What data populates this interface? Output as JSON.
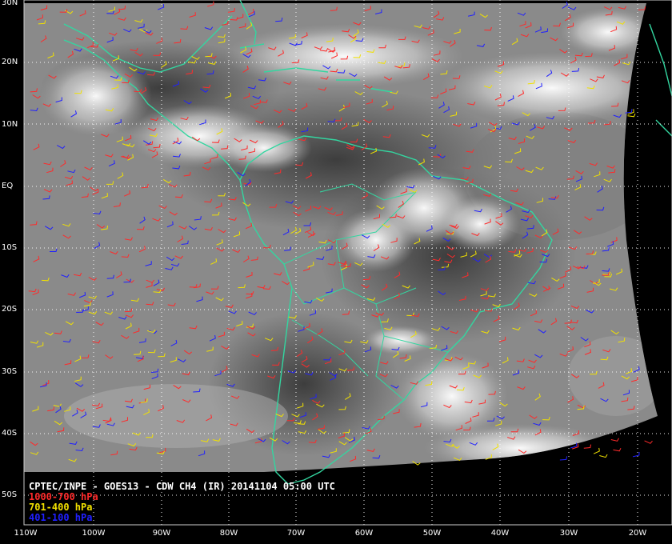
{
  "caption": {
    "title": "CPTEC/INPE - GOES13 - CDW CH4 (IR) 20141104 05:00 UTC",
    "legend": [
      {
        "label": "1000-700 hPa",
        "color": "#ff2a2a"
      },
      {
        "label": "701-400 hPa",
        "color": "#f0e000"
      },
      {
        "label": "401-100 hPa",
        "color": "#2020ff"
      }
    ]
  },
  "lat_labels": [
    "30N",
    "20N",
    "10N",
    "EQ",
    "10S",
    "20S",
    "30S",
    "40S",
    "50S"
  ],
  "lon_labels": [
    "110W",
    "100W",
    "90W",
    "80W",
    "70W",
    "60W",
    "50W",
    "40W",
    "30W",
    "20W"
  ],
  "colors": {
    "coastline": "#33d6a0",
    "grid": "#ffffff",
    "background": "#000000"
  },
  "icons": [
    "wind-barb-icon"
  ]
}
